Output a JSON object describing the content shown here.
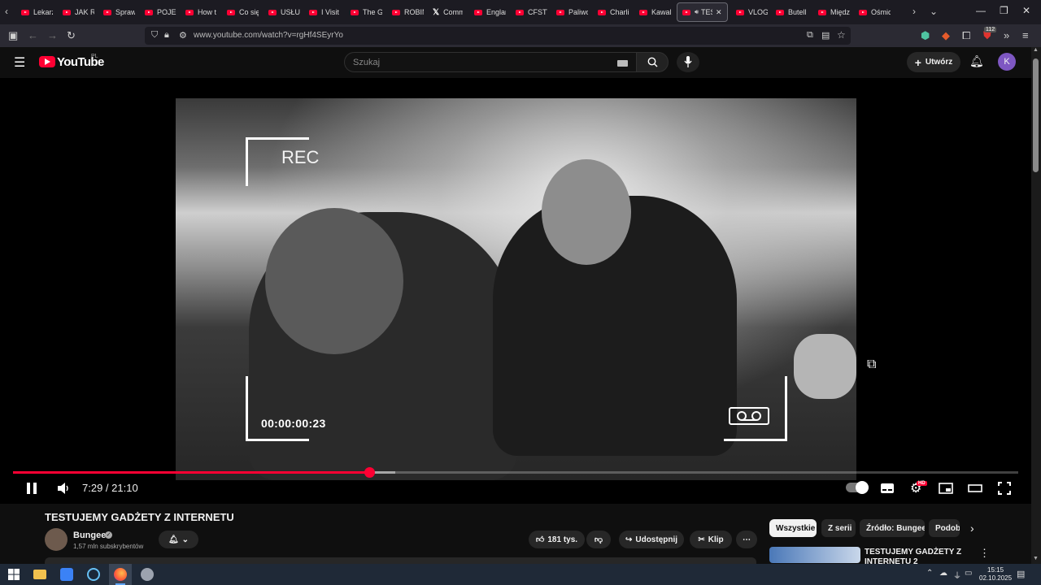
{
  "browser": {
    "tabs": [
      {
        "label": "Lekarz"
      },
      {
        "label": "JAK R"
      },
      {
        "label": "Spraw"
      },
      {
        "label": "POJEC"
      },
      {
        "label": "How t"
      },
      {
        "label": "Co się"
      },
      {
        "label": "USŁUC"
      },
      {
        "label": "I Visit"
      },
      {
        "label": "The G"
      },
      {
        "label": "ROBIN"
      },
      {
        "label": "Comm"
      },
      {
        "label": "Englan"
      },
      {
        "label": "CFSTV"
      },
      {
        "label": "Paliwo"
      },
      {
        "label": "Charli"
      },
      {
        "label": "Kawal"
      },
      {
        "label": "TES"
      },
      {
        "label": "VLOG"
      },
      {
        "label": "Butell"
      },
      {
        "label": "Międz"
      },
      {
        "label": "Ośmic"
      }
    ],
    "url": "www.youtube.com/watch?v=rgHf4SEyrYo",
    "extension_badge": "112"
  },
  "youtube": {
    "logo_text": "YouTube",
    "country_code": "PL",
    "search_placeholder": "Szukaj",
    "create_label": "Utwórz",
    "avatar_letter": "K"
  },
  "player": {
    "video_overlay_timecode": "00:00:00:23",
    "overlay_rec_text": "REC",
    "current_time": "7:29",
    "duration": "21:10",
    "time_display": "7:29 / 21:10",
    "progress_fraction": 0.354,
    "hd_badge": "HD"
  },
  "video_info": {
    "title": "TESTUJEMY GADŻETY Z INTERNETU",
    "channel_name": "Bungee",
    "subscribers": "1,57 mln subskrybentów",
    "likes": "181 tys.",
    "share_label": "Udostępnij",
    "clip_label": "Klip"
  },
  "sidebar": {
    "chips": [
      "Wszystkie",
      "Z serii",
      "Źródło: Bungee",
      "Podob"
    ],
    "first_video_title": "TESTUJEMY GADŻETY Z INTERNETU 2"
  },
  "taskbar": {
    "time": "15:15",
    "date": "02.10.2025"
  },
  "colors": {
    "accent": "#ff0033",
    "background": "#0f0f0f"
  }
}
